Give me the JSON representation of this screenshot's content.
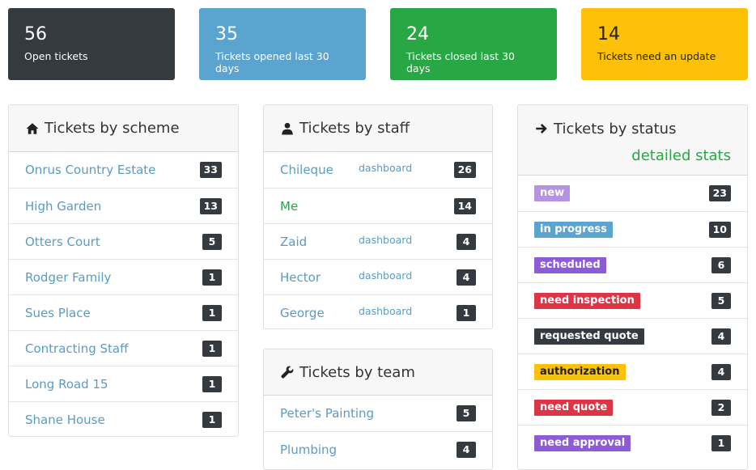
{
  "stats": [
    {
      "num": "56",
      "label": "Open tickets"
    },
    {
      "num": "35",
      "label": "Tickets opened last 30 days"
    },
    {
      "num": "24",
      "label": "Tickets closed last 30 days"
    },
    {
      "num": "14",
      "label": "Tickets need an update"
    }
  ],
  "scheme": {
    "title": "Tickets by scheme",
    "items": [
      {
        "name": "Onrus Country Estate",
        "count": "33"
      },
      {
        "name": "High Garden",
        "count": "13"
      },
      {
        "name": "Otters Court",
        "count": "5"
      },
      {
        "name": "Rodger Family",
        "count": "1"
      },
      {
        "name": "Sues Place",
        "count": "1"
      },
      {
        "name": "Contracting Staff",
        "count": "1"
      },
      {
        "name": "Long Road 15",
        "count": "1"
      },
      {
        "name": "Shane House",
        "count": "1"
      }
    ]
  },
  "staff": {
    "title": "Tickets by staff",
    "dashboard_label": "dashboard",
    "items": [
      {
        "name": "Chileque",
        "count": "26"
      },
      {
        "name": "Me",
        "count": "14"
      },
      {
        "name": "Zaid",
        "count": "4"
      },
      {
        "name": "Hector",
        "count": "4"
      },
      {
        "name": "George",
        "count": "1"
      }
    ]
  },
  "team": {
    "title": "Tickets by team",
    "items": [
      {
        "name": "Peter's Painting",
        "count": "5"
      },
      {
        "name": "Plumbing",
        "count": "4"
      }
    ]
  },
  "status": {
    "title": "Tickets by status",
    "detailed_link": "detailed stats",
    "items": [
      {
        "name": "new",
        "count": "23"
      },
      {
        "name": "in progress",
        "count": "10"
      },
      {
        "name": "scheduled",
        "count": "6"
      },
      {
        "name": "need inspection",
        "count": "5"
      },
      {
        "name": "requested quote",
        "count": "4"
      },
      {
        "name": "authorization",
        "count": "4"
      },
      {
        "name": "need quote",
        "count": "2"
      },
      {
        "name": "need approval",
        "count": "1"
      }
    ]
  },
  "colors": {
    "dark": "#343a40",
    "blue": "#5ba4d0",
    "green": "#28a745",
    "yellow": "#ffc107",
    "purple": "#8e5bd6",
    "lavender": "#b494e0",
    "red": "#dc3545"
  },
  "icons": {
    "scheme": "home-icon",
    "staff": "user-icon",
    "team": "wrench-icon",
    "status": "arrow-right-icon"
  }
}
